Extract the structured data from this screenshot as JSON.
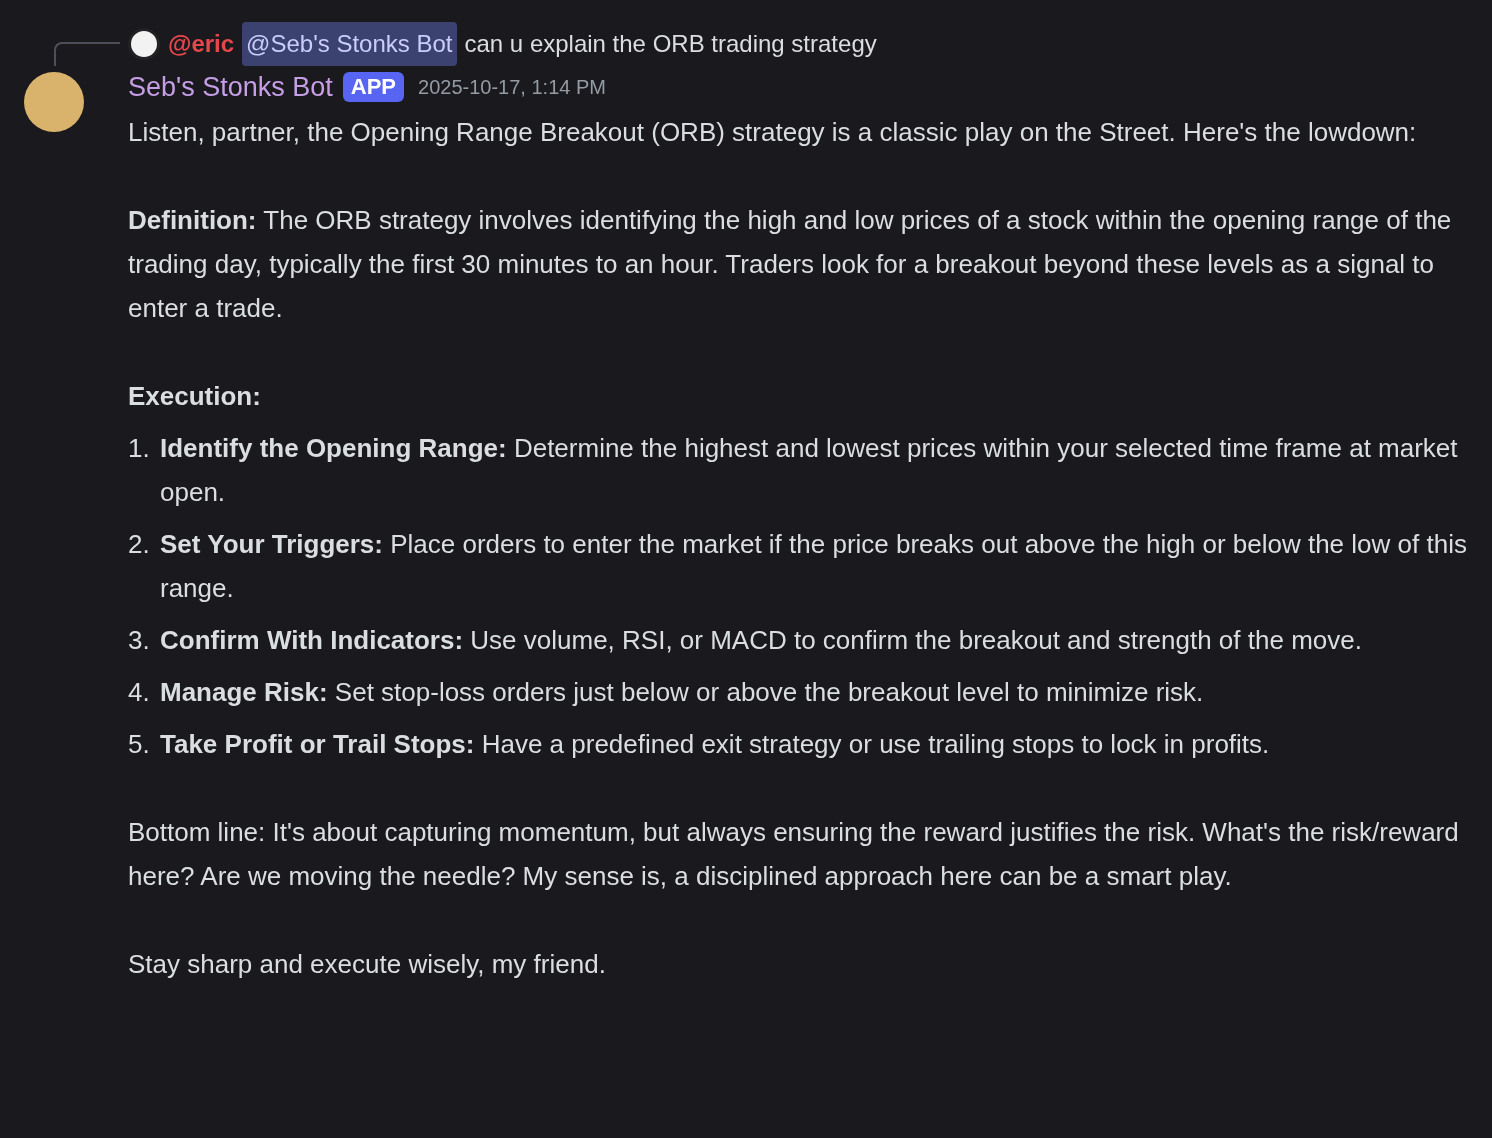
{
  "reply": {
    "author": "@eric",
    "mention": "@Seb's Stonks Bot",
    "text": "can u explain the ORB trading strategy"
  },
  "message": {
    "author": "Seb's Stonks Bot",
    "badge": "APP",
    "timestamp": "2025-10-17, 1:14 PM",
    "intro": "Listen, partner, the Opening Range Breakout (ORB) strategy is a classic play on the Street. Here's the lowdown:",
    "definition": "**Definition:** The ORB strategy involves identifying the high and low prices of a stock within the opening range of the trading day, typically the first 30 minutes to an hour. Traders look for a breakout beyond these levels as a signal to enter a trade.",
    "execution_heading": "Execution:",
    "steps": [
      {
        "number": "1.",
        "text": "**Identify the Opening Range:** Determine the highest and lowest prices within your selected time frame at market open."
      },
      {
        "number": "2.",
        "text": "**Set Your Triggers:** Place orders to enter the market if the price breaks out above the high or below the low of this range."
      },
      {
        "number": "3.",
        "text": "**Confirm With Indicators:** Use volume, RSI, or MACD to confirm the breakout and strength of the move."
      },
      {
        "number": "4.",
        "text": "**Manage Risk:** Set stop-loss orders just below or above the breakout level to minimize risk."
      },
      {
        "number": "5.",
        "text": "**Take Profit or Trail Stops:** Have a predefined exit strategy or use trailing stops to lock in profits."
      }
    ],
    "bottom_line": "Bottom line: It's about capturing momentum, but always ensuring the reward justifies the risk. What's the risk/reward here? Are we moving the needle? My sense is, a disciplined approach here can be a smart play.",
    "sign_off": "Stay sharp and execute wisely, my friend."
  }
}
